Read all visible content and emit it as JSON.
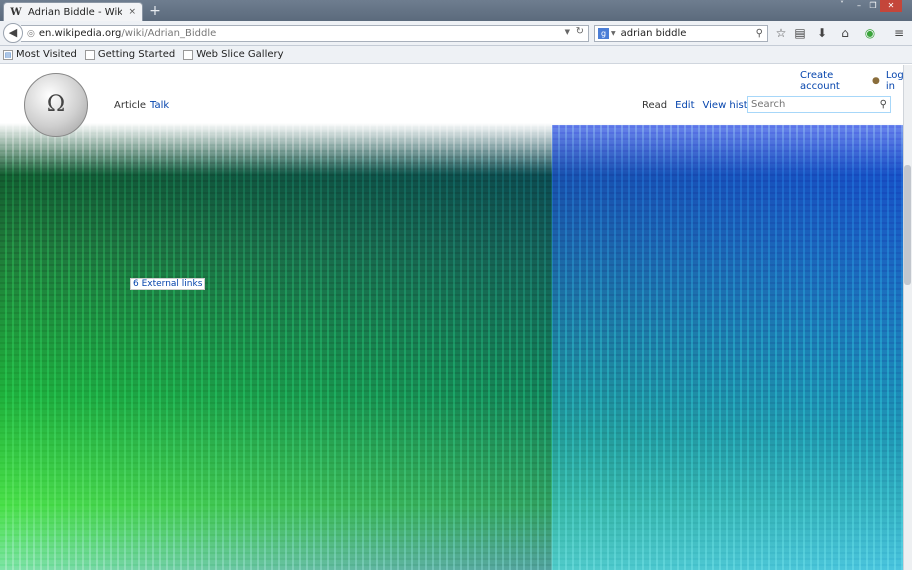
{
  "browser": {
    "tab": {
      "favicon": "W",
      "title": "Adrian Biddle - Wikipedia, the ...",
      "close": "×"
    },
    "new_tab": "+",
    "window_controls": {
      "chevron": "˅",
      "minimize": "–",
      "restore": "❐",
      "close": "✕"
    },
    "url": {
      "host": "en.wikipedia.org",
      "path": "/wiki/Adrian_Biddle"
    },
    "search": {
      "value": "adrian biddle",
      "engine_icon": "g"
    },
    "icons": [
      "back-icon",
      "globe-icon",
      "reload-icon",
      "star-icon",
      "reading-list-icon",
      "download-icon",
      "home-icon",
      "addon-icon",
      "menu-icon"
    ],
    "bookmarks": [
      {
        "label": "Most Visited"
      },
      {
        "label": "Getting Started"
      },
      {
        "label": "Web Slice Gallery"
      }
    ]
  },
  "wiki": {
    "logo_glyph": "Ω",
    "tabs": {
      "article": "Article",
      "talk": "Talk"
    },
    "personal": {
      "create_account": "Create account",
      "login": "Log in"
    },
    "views": {
      "read": "Read",
      "edit": "Edit",
      "history": "View history"
    },
    "search_placeholder": "Search",
    "toc_external_links": "6 External links"
  }
}
